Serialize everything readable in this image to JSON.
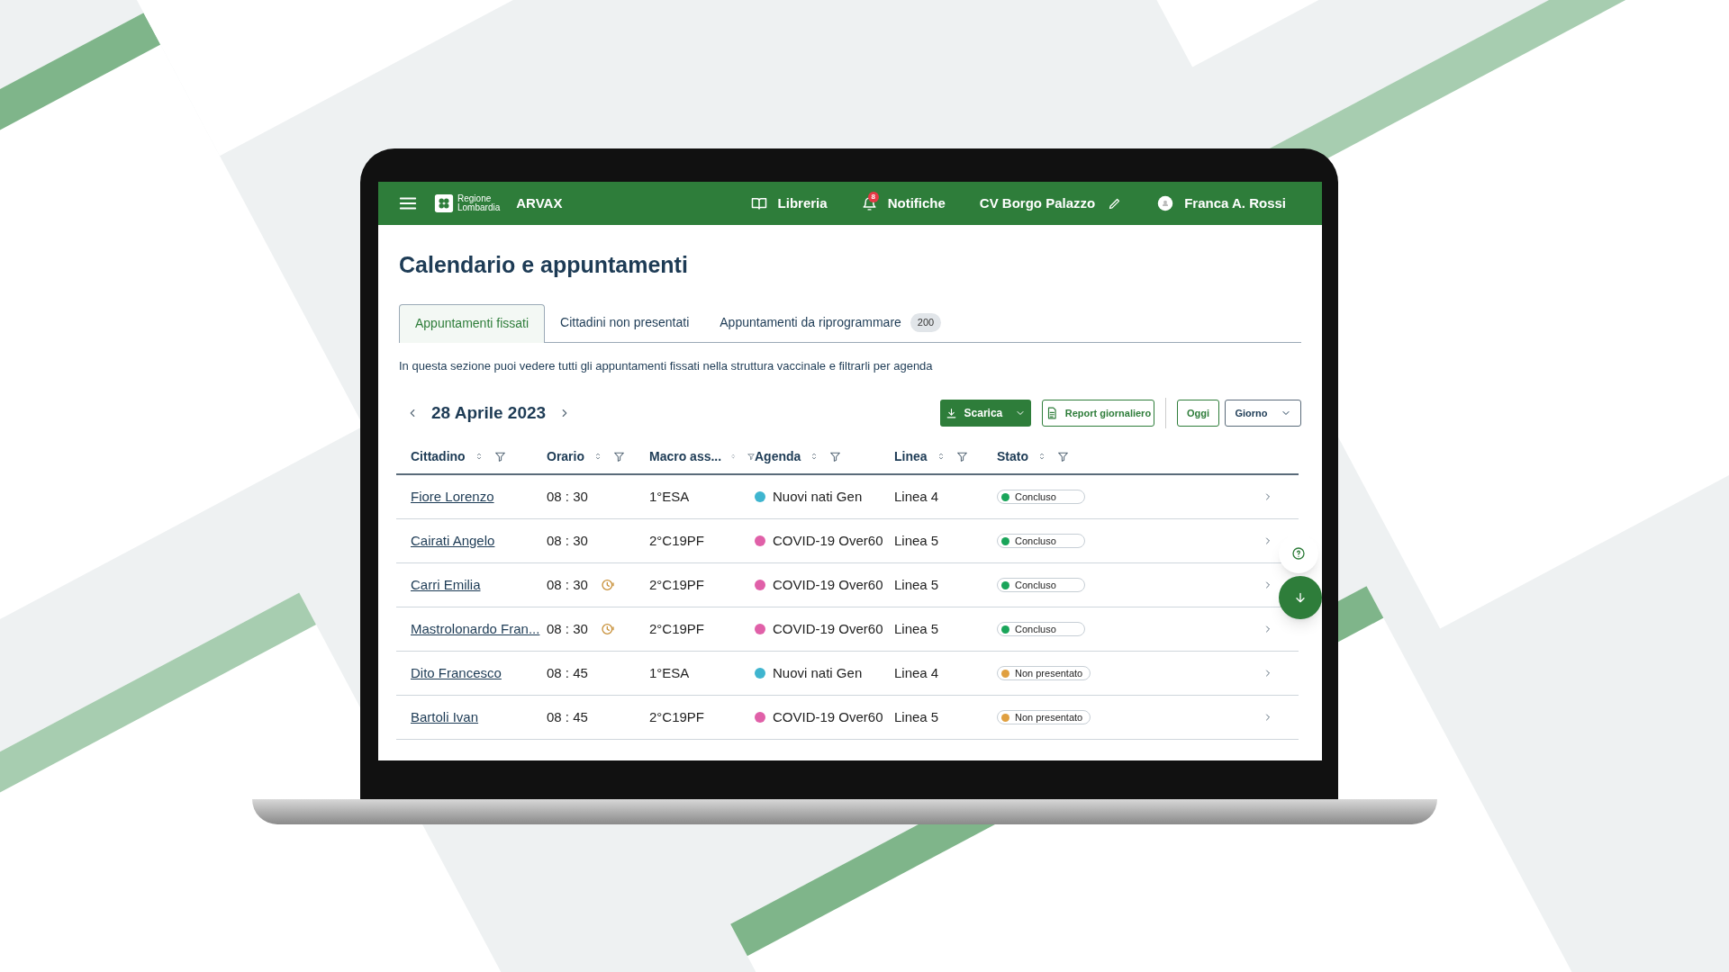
{
  "header": {
    "brand_lines": [
      "Regione",
      "Lombardia"
    ],
    "app_name": "ARVAX",
    "nav": [
      {
        "kind": "library",
        "label": "Libreria"
      },
      {
        "kind": "notifications",
        "label": "Notifiche",
        "badge": "8"
      }
    ],
    "location": "CV Borgo Palazzo",
    "user": "Franca A. Rossi"
  },
  "title": "Calendario e appuntamenti",
  "tabs": [
    {
      "label": "Appuntamenti fissati",
      "selected": true
    },
    {
      "label": "Cittadini non presentati",
      "selected": false
    },
    {
      "label": "Appuntamenti da riprogrammare",
      "selected": false,
      "count": "200"
    }
  ],
  "description": "In questa sezione puoi vedere tutti gli appuntamenti fissati nella struttura vaccinale e filtrarli per agenda",
  "date": "28 Aprile 2023",
  "actions": [
    {
      "kind": "download",
      "label": "Scarica"
    },
    {
      "kind": "report",
      "label": "Report giornaliero"
    },
    {
      "kind": "today",
      "label": "Oggi"
    },
    {
      "kind": "view",
      "label": "Giorno"
    }
  ],
  "table": {
    "columns": [
      "Cittadino",
      "Orario",
      "Macro ass...",
      "Agenda",
      "Linea",
      "Stato"
    ],
    "rows": [
      {
        "cittadino": "Fiore Lorenzo",
        "orario": "08 : 30",
        "late": false,
        "macro": "1°ESA",
        "agenda": {
          "label": "Nuovi nati Gen",
          "color": "#3fb5cf"
        },
        "linea": "Linea 4",
        "stato": {
          "label": "Concluso",
          "color": "#1aa55a"
        }
      },
      {
        "cittadino": "Cairati Angelo",
        "orario": "08 : 30",
        "late": false,
        "macro": "2°C19PF",
        "agenda": {
          "label": "COVID-19 Over60",
          "color": "#e060a8"
        },
        "linea": "Linea 5",
        "stato": {
          "label": "Concluso",
          "color": "#1aa55a"
        }
      },
      {
        "cittadino": "Carri Emilia",
        "orario": "08 : 30",
        "late": true,
        "macro": "2°C19PF",
        "agenda": {
          "label": "COVID-19 Over60",
          "color": "#e060a8"
        },
        "linea": "Linea 5",
        "stato": {
          "label": "Concluso",
          "color": "#1aa55a"
        }
      },
      {
        "cittadino": "Mastrolonardo Fran...",
        "orario": "08 : 30",
        "late": true,
        "macro": "2°C19PF",
        "agenda": {
          "label": "COVID-19 Over60",
          "color": "#e060a8"
        },
        "linea": "Linea 5",
        "stato": {
          "label": "Concluso",
          "color": "#1aa55a"
        }
      },
      {
        "cittadino": "Dito Francesco",
        "orario": "08 : 45",
        "late": false,
        "macro": "1°ESA",
        "agenda": {
          "label": "Nuovi nati Gen",
          "color": "#3fb5cf"
        },
        "linea": "Linea 4",
        "stato": {
          "label": "Non presentato",
          "color": "#e0a040"
        }
      },
      {
        "cittadino": "Bartoli Ivan",
        "orario": "08 : 45",
        "late": false,
        "macro": "2°C19PF",
        "agenda": {
          "label": "COVID-19 Over60",
          "color": "#e060a8"
        },
        "linea": "Linea 5",
        "stato": {
          "label": "Non presentato",
          "color": "#e0a040"
        }
      }
    ]
  }
}
